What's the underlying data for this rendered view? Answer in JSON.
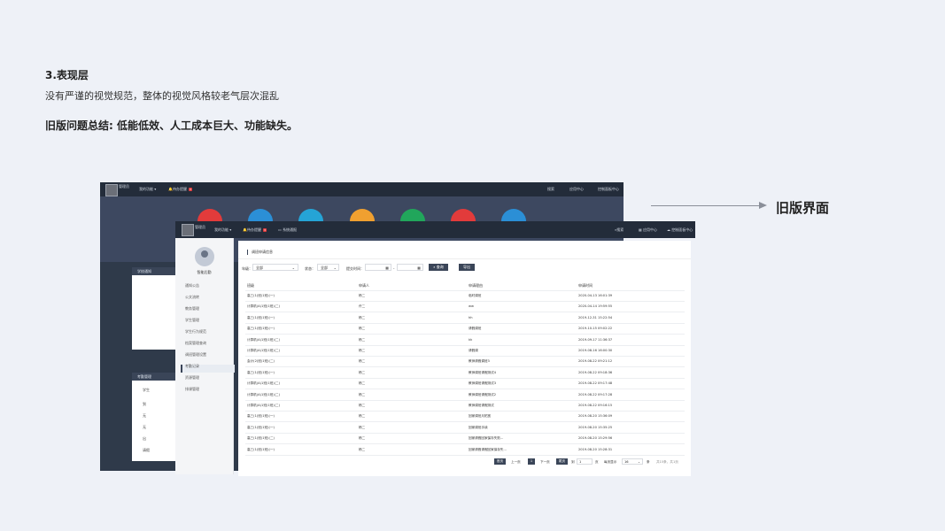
{
  "slide": {
    "title": "3.表现层",
    "desc": "没有严谨的视觉规范，整体的视觉风格较老气层次混乱",
    "summary": "旧版问题总结: 低能低效、人工成本巨大、功能缺失。",
    "old_label": "旧版界面",
    "arrow_color": "#8a8f99"
  },
  "back_shot": {
    "user": "管理员",
    "menu": [
      "我的功能 ▾",
      "待办提醒"
    ],
    "badge": "3",
    "right": [
      "搜索",
      "应用中心",
      "控制面板中心"
    ],
    "circle_colors": [
      "#e23b3b",
      "#2b8fd6",
      "#25a4d6",
      "#f0a030",
      "#21a65b",
      "#e23b3b",
      "#2b8fd6"
    ],
    "card1_title": "学校通知",
    "card2_title": "考勤管理",
    "card2_items": [
      "学生",
      "到",
      "无",
      "无",
      "出",
      "请假"
    ]
  },
  "front_shot": {
    "user": "管理员",
    "menu": [
      "我的功能 ▾",
      "待办提醒",
      "系统通报"
    ],
    "badge": "3",
    "right": [
      "搜索",
      "应用中心",
      "控制面板中心"
    ],
    "side_name": "智能后勤",
    "side_items": [
      "通知公告",
      "公文流转",
      "教务管理",
      "学生管理",
      "学生行为规范",
      "档案管理查询",
      "调班管理设置",
      "考勤记录",
      "资源管理",
      "排课管理"
    ],
    "page_title": "调班申请信息",
    "filters": {
      "grade_label": "年级：",
      "grade_value": "全部",
      "subject_label": "状态：",
      "subject_value": "全部",
      "time_label": "提交时间：",
      "date_sep": "-",
      "search_btn": "查询",
      "export_btn": "导出"
    },
    "columns": [
      "班级",
      "申请人",
      "申请理由",
      "申请时间"
    ],
    "rows": [
      [
        "高三(1)班(1班)(一)",
        "杨二",
        "临时调班",
        "2020-04-13 16:01:39"
      ],
      [
        "计算机(A)1班(1班)(二)",
        "许二",
        "ww",
        "2020-04-14 19:59:55"
      ],
      [
        "高三(1)班(1班)(一)",
        "杨二",
        "hh",
        "2019-12-31 15:22:54"
      ],
      [
        "高三(1)班(1班)(一)",
        "杨二",
        "请假调班",
        "2019-10-15 09:02:22"
      ],
      [
        "计算机(A)1班(1班)(二)",
        "杨二",
        "kk",
        "2019-09-17 11:36:37"
      ],
      [
        "计算机(A)1班(1班)(二)",
        "杨二",
        "请假调",
        "2019-08-16 16:00:30"
      ],
      [
        "会计(2)班(1班)(二)",
        "杨二",
        "教师请假调班3",
        "2019-08-22 09:21:12"
      ],
      [
        "高三(1)班(1班)(一)",
        "杨二",
        "教师调班请假测试4",
        "2019-08-22 09:18:36"
      ],
      [
        "计算机(A)1班(1班)(二)",
        "杨二",
        "教师调班请假测试3",
        "2019-08-22 09:17:48"
      ],
      [
        "计算机(A)1班(1班)(二)",
        "杨二",
        "教师调班请假测试2",
        "2019-08-22 09:17:28"
      ],
      [
        "计算机(A)1班(1班)(二)",
        "杨二",
        "教师调班请假测试",
        "2019-08-22 09:16:15"
      ],
      [
        "高三(1)班(1班)(一)",
        "杨二",
        "回家调班月拓宽",
        "2019-08-20 15:36:09"
      ],
      [
        "高三(1)班(1班)(一)",
        "杨二",
        "回家调班手续",
        "2019-08-20 15:35:25"
      ],
      [
        "高三(1)班(1班)(二)",
        "杨二",
        "回家请假回家保存失败...",
        "2019-08-20 15:29:56"
      ],
      [
        "高三(1)班(1班)(一)",
        "杨二",
        "回家请假请假回家保存失...",
        "2019-08-20 15:28:31"
      ]
    ],
    "pagination": {
      "first": "首页",
      "prev": "上一页",
      "current": "1",
      "next": "下一页",
      "last": "尾页",
      "goto_pre": "到",
      "goto_value": "1",
      "goto_post": "页",
      "per_page_label": "每页显示",
      "per_page_value": "16",
      "per_page_unit": "条",
      "total": "共15条，共1页"
    }
  }
}
